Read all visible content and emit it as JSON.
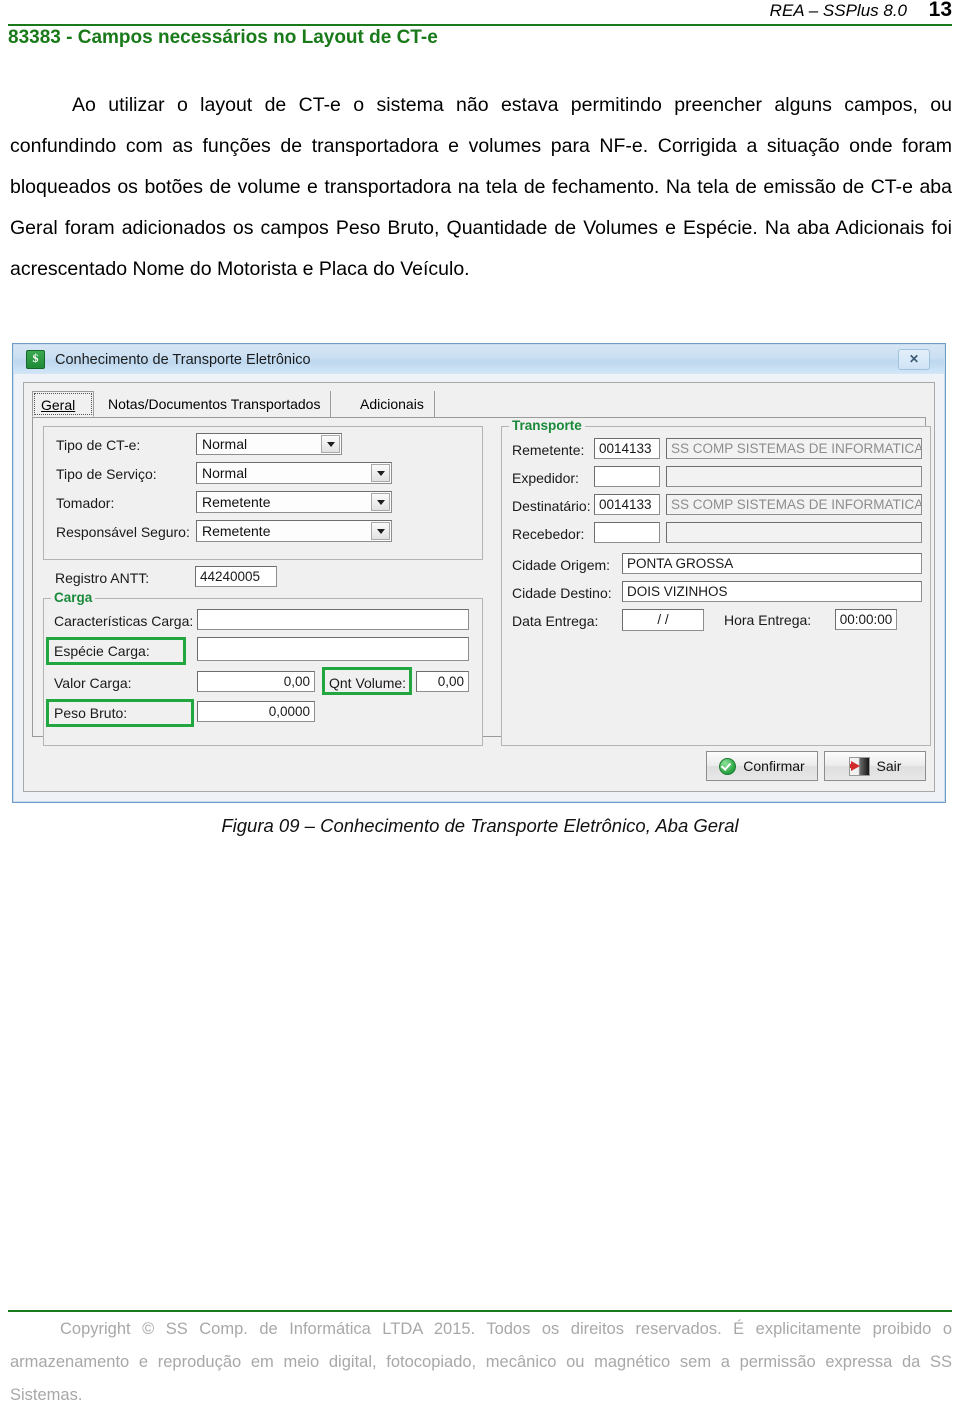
{
  "header": {
    "running_head": "REA – SSPlus 8.0",
    "page_number": "13",
    "rule_color": "#1a7a1a"
  },
  "document": {
    "title": "83383 - Campos necessários no Layout de CT-e",
    "title_color": "#1a7a1a",
    "body": "Ao utilizar o layout de CT-e o sistema não estava permitindo preencher alguns campos, ou confundindo com as funções de transportadora e volumes para NF-e. Corrigida a situação onde foram bloqueados os botões de volume e transportadora na tela de fechamento. Na tela de emissão de CT-e aba Geral foram adicionados os campos Peso Bruto, Quantidade de Volumes e Espécie. Na aba Adicionais foi acrescentado Nome do Motorista e Placa do Veículo.",
    "figure_caption": "Figura 09 – Conhecimento de Transporte Eletrônico, Aba Geral"
  },
  "footer": {
    "text": "Copyright © SS Comp. de Informática LTDA 2015. Todos os direitos reservados. É explicitamente proibido o armazenamento e reprodução em meio digital, fotocopiado, mecânico ou magnético sem a permissão expressa da SS Sistemas.",
    "color": "#a8a8a8"
  },
  "dialog": {
    "title": "Conhecimento de Transporte Eletrônico",
    "icon": "money-app-icon",
    "close_label": "✕",
    "tabs": [
      {
        "label": "Geral",
        "active": true
      },
      {
        "label": "Notas/Documentos Transportados",
        "active": false
      },
      {
        "label": "Adicionais",
        "active": false
      }
    ],
    "general_fields": [
      {
        "label": "Tipo de CT-e:",
        "value": "Normal",
        "type": "combo"
      },
      {
        "label": "Tipo de Serviço:",
        "value": "Normal",
        "type": "combo"
      },
      {
        "label": "Tomador:",
        "value": "Remetente",
        "type": "combo"
      },
      {
        "label": "Responsável Seguro:",
        "value": "Remetente",
        "type": "combo"
      },
      {
        "label": "Registro ANTT:",
        "value": "44240005",
        "type": "text"
      }
    ],
    "carga": {
      "legend": "Carga",
      "legend_color": "#1a8a3a",
      "fields": [
        {
          "label": "Características Carga:",
          "value": "",
          "highlighted": false
        },
        {
          "label": "Espécie Carga:",
          "value": "",
          "highlighted": true
        },
        {
          "label": "Valor Carga:",
          "value": "0,00",
          "highlighted": false
        },
        {
          "label": "Qnt Volume:",
          "value": "0,00",
          "highlighted": true
        },
        {
          "label": "Peso Bruto:",
          "value": "0,0000",
          "highlighted": true
        }
      ]
    },
    "transporte": {
      "legend": "Transporte",
      "legend_color": "#1a8a3a",
      "rows": [
        {
          "label": "Remetente:",
          "code": "0014133",
          "name": "SS COMP SISTEMAS DE INFORMATICA LTD"
        },
        {
          "label": "Expedidor:",
          "code": "",
          "name": ""
        },
        {
          "label": "Destinatário:",
          "code": "0014133",
          "name": "SS COMP SISTEMAS DE INFORMATICA LTD"
        },
        {
          "label": "Recebedor:",
          "code": "",
          "name": ""
        }
      ],
      "cidade_origem_label": "Cidade Origem:",
      "cidade_origem_value": "PONTA GROSSA",
      "cidade_destino_label": "Cidade Destino:",
      "cidade_destino_value": "DOIS VIZINHOS",
      "data_entrega_label": "Data Entrega:",
      "data_entrega_value": "/  /",
      "hora_entrega_label": "Hora Entrega:",
      "hora_entrega_value": "00:00:00"
    },
    "buttons": {
      "confirm": "Confirmar",
      "confirm_icon": "green-check-icon",
      "exit": "Sair",
      "exit_icon": "red-exit-arrow-icon"
    },
    "highlight_color": "#22a63f"
  }
}
